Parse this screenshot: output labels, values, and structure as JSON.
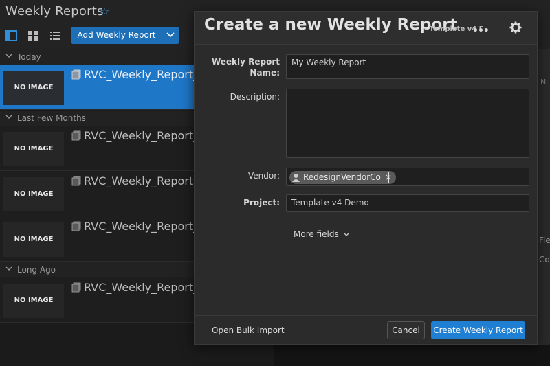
{
  "app": {
    "title": "Weekly Reports",
    "add_button": "Add Weekly Report"
  },
  "list": {
    "groups": [
      {
        "label": "Today"
      },
      {
        "label": "Last Few Months"
      },
      {
        "label": "Long Ago"
      }
    ],
    "rows": [
      {
        "title": "RVC_Weekly_Report_",
        "thumb": "NO IMAGE"
      },
      {
        "title": "RVC_Weekly_Report_",
        "thumb": "NO IMAGE"
      },
      {
        "title": "RVC_Weekly_Report_",
        "thumb": "NO IMAGE"
      },
      {
        "title": "RVC_Weekly_Report_",
        "thumb": "NO IMAGE"
      },
      {
        "title": "RVC_Weekly_Report_",
        "thumb": "NO IMAGE"
      }
    ]
  },
  "right_pane": {
    "frag1": "N.",
    "frag2": "Fie",
    "frag3": "Co"
  },
  "modal": {
    "title": "Create a new Weekly Report",
    "subtitle": "- Template v4 D",
    "fields": {
      "name_label": "Weekly Report Name:",
      "name_placeholder": "My Weekly Report",
      "description_label": "Description:",
      "description_value": "",
      "vendor_label": "Vendor:",
      "vendor_chip": "RedesignVendorCo",
      "project_label": "Project:",
      "project_value": "Template v4 Demo"
    },
    "more_fields": "More fields",
    "footer": {
      "bulk_import": "Open Bulk Import",
      "cancel": "Cancel",
      "create": "Create Weekly Report"
    }
  },
  "colors": {
    "accent": "#1f7fd3",
    "selected_row": "#1f77c8",
    "background": "#1a1a1a"
  }
}
